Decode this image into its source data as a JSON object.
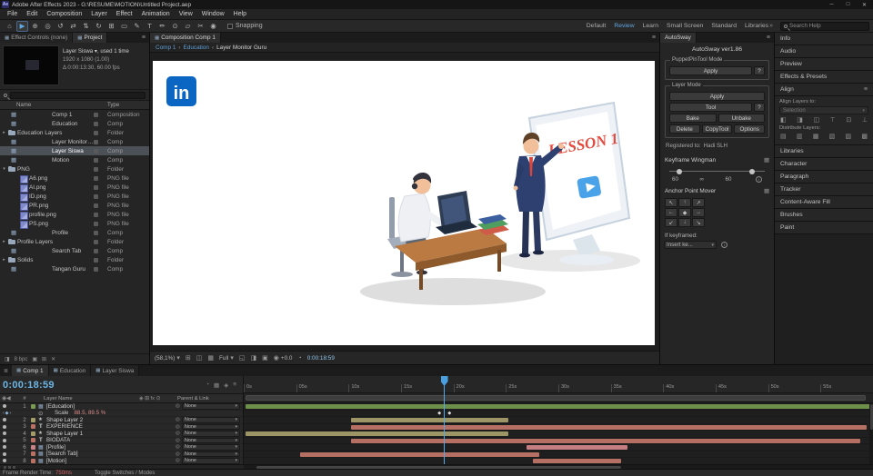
{
  "titlebar": {
    "app_badge": "Ae",
    "title": "Adobe After Effects 2023 - G:\\RESUME\\MOTION\\Untitled Project.aep"
  },
  "menubar": {
    "items": [
      "File",
      "Edit",
      "Composition",
      "Layer",
      "Effect",
      "Animation",
      "View",
      "Window",
      "Help"
    ]
  },
  "toolbar": {
    "tools": [
      {
        "glyph": "⌂",
        "name": "home",
        "state": ""
      },
      {
        "glyph": "▶",
        "name": "selection",
        "state": "active"
      },
      {
        "glyph": "⊕",
        "name": "hand",
        "state": ""
      },
      {
        "glyph": "◎",
        "name": "zoom",
        "state": ""
      },
      {
        "glyph": "↺",
        "name": "orbit-camera",
        "state": ""
      },
      {
        "glyph": "⇄",
        "name": "pan-camera",
        "state": ""
      },
      {
        "glyph": "⇅",
        "name": "dolly-camera",
        "state": ""
      },
      {
        "glyph": "↻",
        "name": "rotation",
        "state": ""
      },
      {
        "glyph": "⊞",
        "name": "pan-behind",
        "state": ""
      },
      {
        "glyph": "▭",
        "name": "shape",
        "state": ""
      },
      {
        "glyph": "✎",
        "name": "pen",
        "state": ""
      },
      {
        "glyph": "T",
        "name": "type",
        "state": ""
      },
      {
        "glyph": "✏",
        "name": "brush",
        "state": ""
      },
      {
        "glyph": "⊙",
        "name": "clone-stamp",
        "state": ""
      },
      {
        "glyph": "▱",
        "name": "eraser",
        "state": ""
      },
      {
        "glyph": "✂",
        "name": "roto-brush",
        "state": ""
      },
      {
        "glyph": "◉",
        "name": "puppet-pin",
        "state": ""
      }
    ],
    "snapping_label": "Snapping",
    "workspaces": [
      {
        "label": "Default",
        "state": ""
      },
      {
        "label": "Review",
        "state": "active"
      },
      {
        "label": "Learn",
        "state": ""
      },
      {
        "label": "Small Screen",
        "state": ""
      },
      {
        "label": "Standard",
        "state": ""
      },
      {
        "label": "Libraries",
        "state": ""
      }
    ],
    "search_placeholder": "Search Help"
  },
  "project": {
    "tabs": [
      {
        "label": "Effect Controls (none)",
        "state": ""
      },
      {
        "label": "Project",
        "state": "active"
      }
    ],
    "preview": {
      "line1": "Layer Siswa ▾, used 1 time",
      "line2": "1920 x 1080 (1.00)",
      "line3": "Δ 0:00:13:30, 60.00 fps"
    },
    "columns": {
      "name": "Name",
      "type": "Type"
    },
    "items": [
      {
        "name": "Comp 1",
        "type": "Composition",
        "icon": "comp",
        "tw": "",
        "pad": "4px",
        "state": ""
      },
      {
        "name": "Education",
        "type": "Comp",
        "icon": "comp",
        "tw": "",
        "pad": "4px",
        "state": ""
      },
      {
        "name": "Education Layers",
        "type": "Folder",
        "icon": "folder",
        "tw": "▸",
        "pad": "1px",
        "state": ""
      },
      {
        "name": "Layer Monitor Guru",
        "type": "Comp",
        "icon": "comp",
        "tw": "",
        "pad": "4px",
        "state": ""
      },
      {
        "name": "Layer Siswa",
        "type": "Comp",
        "icon": "comp",
        "tw": "",
        "pad": "4px",
        "state": "selected"
      },
      {
        "name": "Motion",
        "type": "Comp",
        "icon": "comp",
        "tw": "",
        "pad": "4px",
        "state": ""
      },
      {
        "name": "PNG",
        "type": "Folder",
        "icon": "folder",
        "tw": "▾",
        "pad": "1px",
        "state": ""
      },
      {
        "name": "A6.png",
        "type": "PNG file",
        "icon": "png",
        "tw": "",
        "pad": "14px",
        "state": ""
      },
      {
        "name": "AI.png",
        "type": "PNG file",
        "icon": "png",
        "tw": "",
        "pad": "14px",
        "state": ""
      },
      {
        "name": "ID.png",
        "type": "PNG file",
        "icon": "png",
        "tw": "",
        "pad": "14px",
        "state": ""
      },
      {
        "name": "PR.png",
        "type": "PNG file",
        "icon": "png",
        "tw": "",
        "pad": "14px",
        "state": ""
      },
      {
        "name": "profile.png",
        "type": "PNG file",
        "icon": "png",
        "tw": "",
        "pad": "14px",
        "state": ""
      },
      {
        "name": "PS.png",
        "type": "PNG file",
        "icon": "png",
        "tw": "",
        "pad": "14px",
        "state": ""
      },
      {
        "name": "Profile",
        "type": "Comp",
        "icon": "comp",
        "tw": "",
        "pad": "4px",
        "state": ""
      },
      {
        "name": "Profile Layers",
        "type": "Folder",
        "icon": "folder",
        "tw": "▸",
        "pad": "1px",
        "state": ""
      },
      {
        "name": "Search Tab",
        "type": "Comp",
        "icon": "comp",
        "tw": "",
        "pad": "4px",
        "state": ""
      },
      {
        "name": "Solids",
        "type": "Folder",
        "icon": "folder",
        "tw": "▸",
        "pad": "1px",
        "state": ""
      },
      {
        "name": "Tangan Guru",
        "type": "Comp",
        "icon": "comp",
        "tw": "",
        "pad": "4px",
        "state": ""
      }
    ],
    "footer_bpc": "8 bpc"
  },
  "composition": {
    "tab_label": "Composition Comp 1",
    "breadcrumb": [
      {
        "label": "Comp 1",
        "state": "link"
      },
      {
        "label": "Education",
        "state": "link"
      },
      {
        "label": "Layer Monitor Guru",
        "state": ""
      }
    ],
    "canvas": {
      "linkedin": "in",
      "lesson": "LESSON 1"
    },
    "status": {
      "zoom": "(58,1%)",
      "resolution": "Full",
      "exposure": "+0.0",
      "time": "0:00:18:59"
    }
  },
  "autosway": {
    "tab_label": "AutoSway",
    "version": "AutoSway ver1.86",
    "puppet_group_title": "PuppetPinTool Mode",
    "puppet_apply": "Apply",
    "puppet_help": "?",
    "layer_group_title": "Layer Mode",
    "layer_apply": "Apply",
    "layer_tool": "Tool",
    "layer_help": "?",
    "bake": "Bake",
    "unbake": "Unbake",
    "delete": "Delete",
    "copytool": "CopyTool",
    "options": "Options",
    "registered_label": "Registered to:",
    "registered_value": "Hadi SLH",
    "wingman_title": "Keyframe Wingman",
    "wingman_left": "60",
    "wingman_mid": "∞",
    "wingman_right": "60",
    "anchor_title": "Anchor Point Mover",
    "anchor_arrows": [
      "↖",
      "↑",
      "↗",
      "←",
      "◆",
      "→",
      "↙",
      "↓",
      "↘"
    ],
    "if_keyframed": "If keyframed:",
    "insert_value": "Insert ke..."
  },
  "dock": {
    "above": [
      "Info",
      "Audio",
      "Preview",
      "Effects & Presets"
    ],
    "align_title": "Align",
    "align_layers_label": "Align Layers to:",
    "align_layers_value": "Selection",
    "align_icons": [
      "◧",
      "◨",
      "◫",
      "⊤",
      "⊡",
      "⊥"
    ],
    "distribute_label": "Distribute Layers:",
    "distribute_icons": [
      "▤",
      "▥",
      "▦",
      "▧",
      "▨",
      "▩"
    ],
    "below": [
      "Libraries",
      "Character",
      "Paragraph",
      "Tracker",
      "Content-Aware Fill",
      "Brushes",
      "Paint"
    ]
  },
  "timeline": {
    "tabs": [
      {
        "label": "Comp 1",
        "state": "active"
      },
      {
        "label": "Education",
        "state": ""
      },
      {
        "label": "Layer Siswa",
        "state": ""
      }
    ],
    "timecode": "0:00:18:59",
    "col_layer_name": "Layer Name",
    "col_parent": "Parent & Link",
    "ruler": [
      "0s",
      "05s",
      "10s",
      "15s",
      "20s",
      "25s",
      "30s",
      "35s",
      "40s",
      "45s",
      "50s",
      "55s"
    ],
    "playhead_left": "31.8%",
    "layers": [
      {
        "kind": "layer",
        "num": "1",
        "icon": "comp",
        "name": "[Education]",
        "parent": "None",
        "chip": "#7a9b52",
        "bar": {
          "left": "0.3%",
          "width": "99.4%",
          "color": "#6e8f49"
        }
      },
      {
        "kind": "prop",
        "num": "",
        "icon": "stopwatch",
        "name": "Scale",
        "value": "88.5, 89.5 %",
        "parent": "",
        "kf1": "31.1%",
        "kf2": "32.7%"
      },
      {
        "kind": "layer",
        "num": "2",
        "icon": "shape",
        "name": "Shape Layer 2",
        "parent": "None",
        "chip": "#a59d68",
        "bar": {
          "left": "17%",
          "width": "25%",
          "color": "#9d9565"
        }
      },
      {
        "kind": "layer",
        "num": "3",
        "icon": "text",
        "name": "EXPERIENCE",
        "parent": "None",
        "chip": "#bd7165",
        "bar": {
          "left": "17%",
          "width": "82%",
          "color": "#b56f63"
        }
      },
      {
        "kind": "layer",
        "num": "4",
        "icon": "shape",
        "name": "Shape Layer 1",
        "parent": "None",
        "chip": "#a59d68",
        "bar": {
          "left": "0.3%",
          "width": "41.7%",
          "color": "#9d9565"
        }
      },
      {
        "kind": "layer",
        "num": "5",
        "icon": "text",
        "name": "BIODATA",
        "parent": "None",
        "chip": "#bd7165",
        "bar": {
          "left": "17%",
          "width": "81%",
          "color": "#b56f63"
        }
      },
      {
        "kind": "layer",
        "num": "6",
        "icon": "comp",
        "name": "[Profile]",
        "parent": "None",
        "chip": "#c98286",
        "bar": {
          "left": "45%",
          "width": "16%",
          "color": "#c47e82"
        }
      },
      {
        "kind": "layer",
        "num": "7",
        "icon": "comp",
        "name": "[Search Tab]",
        "parent": "None",
        "chip": "#bd7165",
        "bar": {
          "left": "9%",
          "width": "38%",
          "color": "#b56f63"
        }
      },
      {
        "kind": "layer",
        "num": "8",
        "icon": "comp",
        "name": "[Motion]",
        "parent": "None",
        "chip": "#bd7165",
        "bar": {
          "left": "46%",
          "width": "14%",
          "color": "#b56f63"
        }
      }
    ],
    "toggle_label": "Toggle Switches / Modes"
  },
  "statusbar": {
    "render_label": "Frame Render Time:",
    "render_value": "750ms"
  },
  "colors": {
    "accent_blue": "#5fa9e6",
    "timecode_blue": "#6cb6e4",
    "render_warn": "#d06060",
    "linkedin_blue": "#0a66c2"
  }
}
